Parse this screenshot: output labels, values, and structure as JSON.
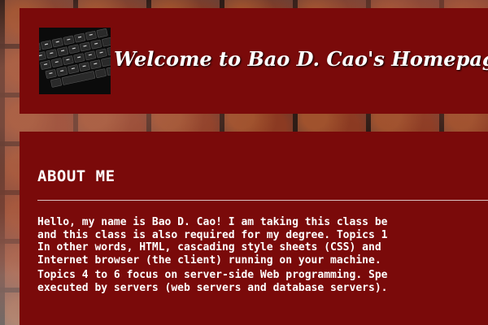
{
  "header": {
    "title": "Welcome to Bao D. Cao's Homepage",
    "logo_icon": "keyboard-icon"
  },
  "about": {
    "heading": "ABOUT ME",
    "paragraph_1": [
      "Hello, my name is Bao D. Cao! I am taking this class be",
      "and this class is also required for my degree. Topics 1",
      "In other words, HTML, cascading style sheets (CSS) and",
      "Internet browser (the client) running on your machine."
    ],
    "paragraph_2": [
      "Topics 4 to 6 focus on server-side Web programming. Spe",
      "executed by servers (web servers and database servers)."
    ]
  },
  "colors": {
    "panel": "#7a0a0a",
    "text": "#ffffff"
  }
}
